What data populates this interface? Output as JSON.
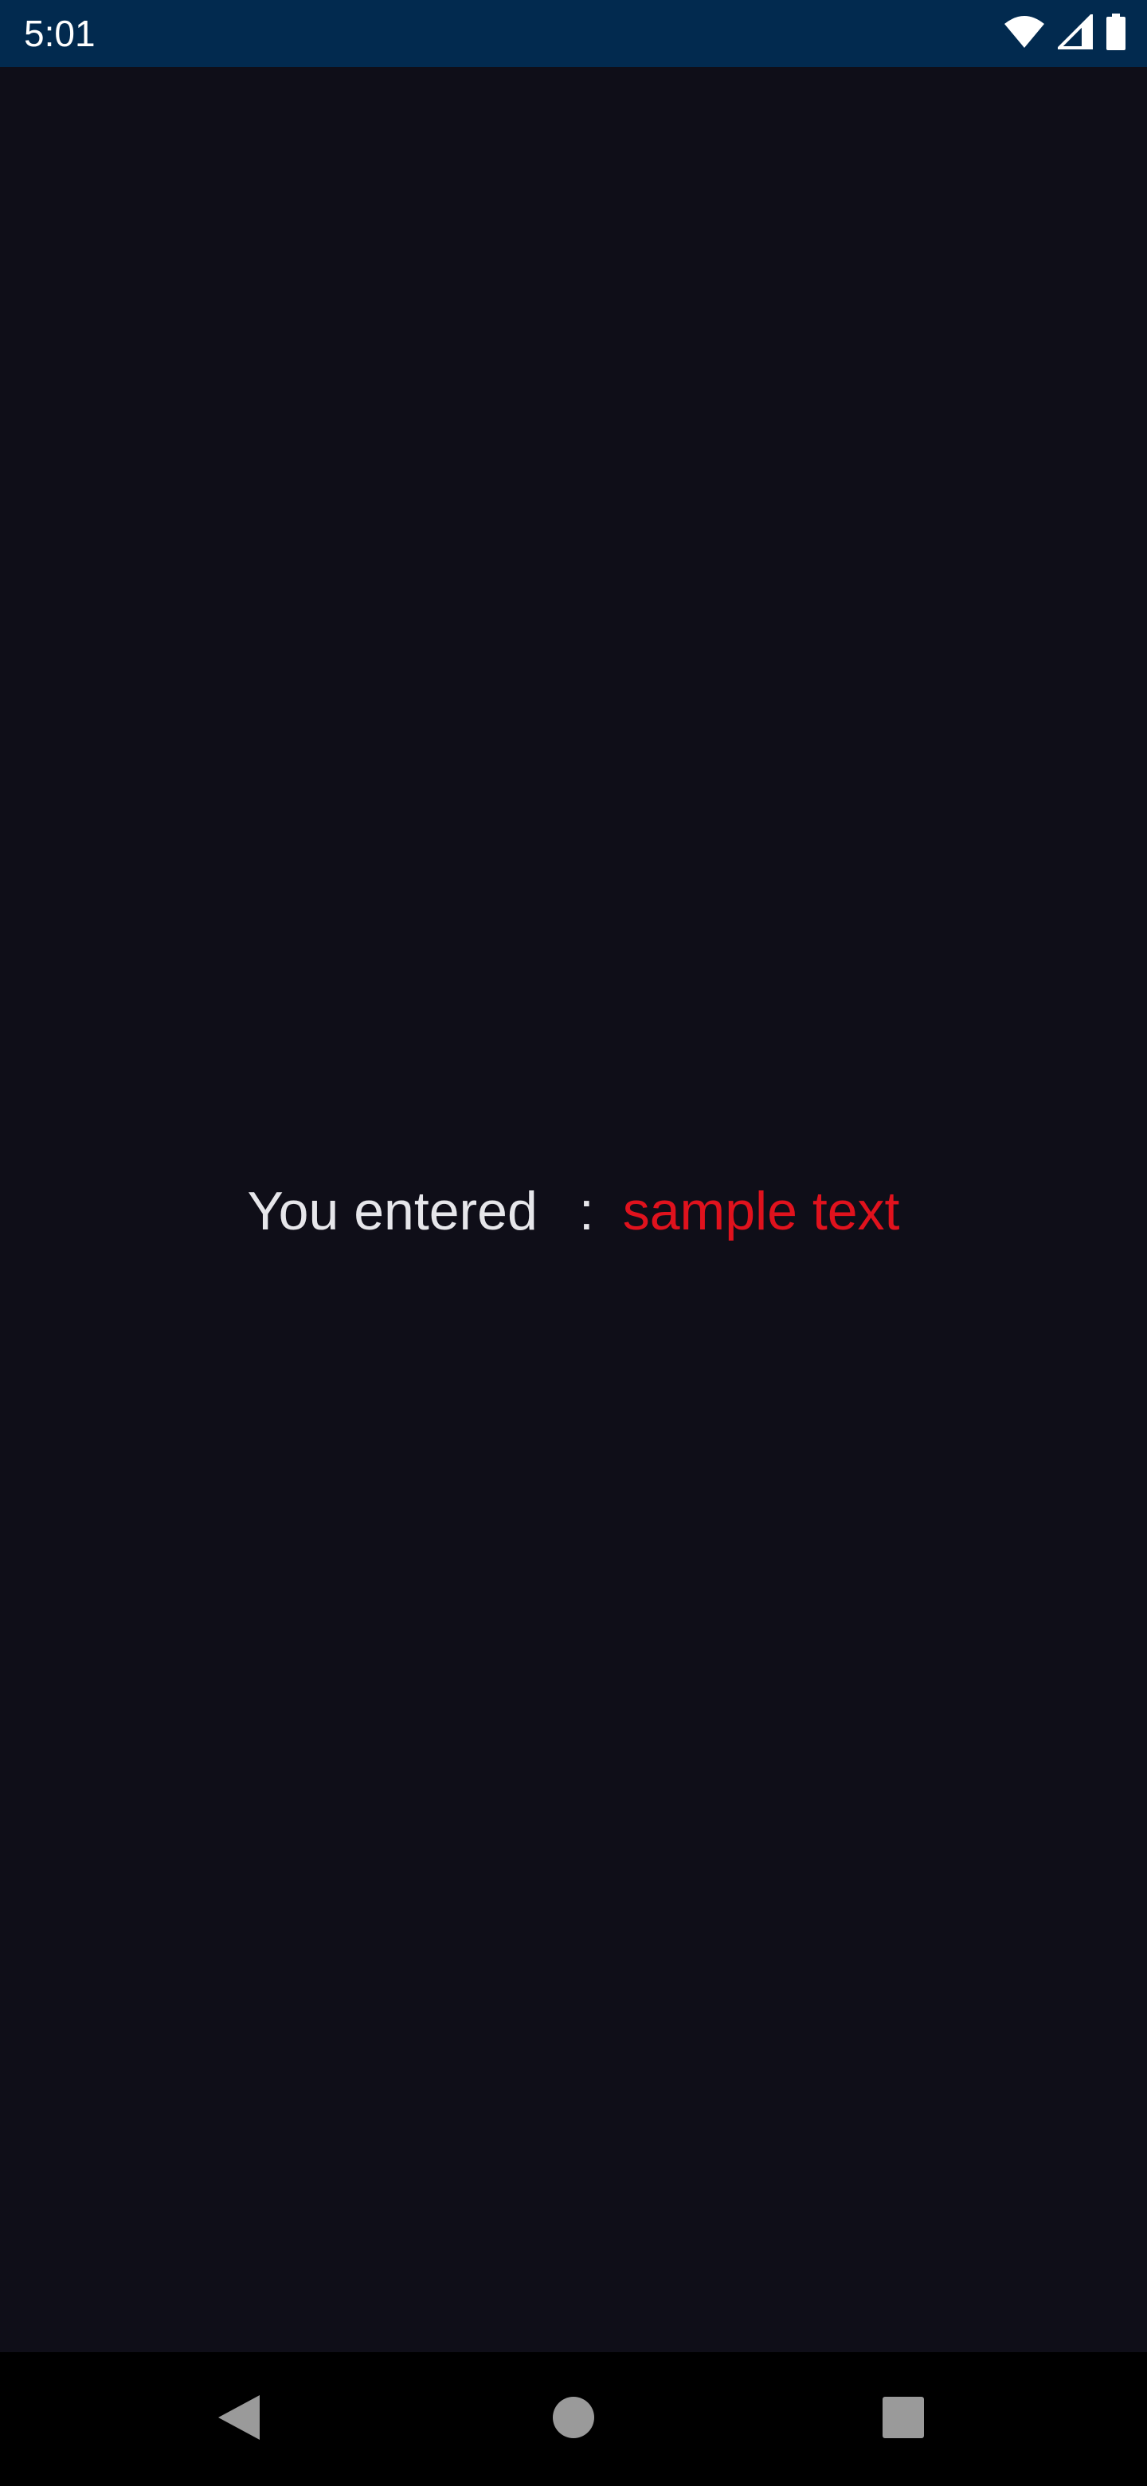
{
  "status_bar": {
    "time": "5:01",
    "icons": [
      "wifi-icon",
      "signal-icon",
      "battery-icon"
    ]
  },
  "entry": {
    "label": "You entered",
    "separator": ":",
    "value": "sample text"
  },
  "nav_bar": {
    "buttons": [
      "back-icon",
      "home-icon",
      "recents-icon"
    ]
  },
  "colors": {
    "status_bar_bg": "#022a4f",
    "background": "#0f0e18",
    "label_text": "#e6e6ea",
    "value_text": "#e0121d",
    "nav_bar_bg": "#000000",
    "nav_icon": "#9a9a9a"
  }
}
